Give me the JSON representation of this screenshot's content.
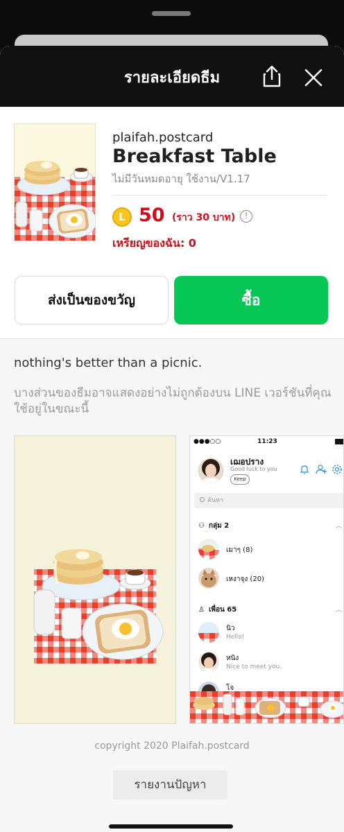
{
  "header": {
    "title": "รายละเอียดธีม"
  },
  "theme": {
    "author": "plaifah.postcard",
    "title": "Breakfast Table",
    "validity": "ไม่มีวันหมดอายุ ใช้งาน/V1.17",
    "coin_letter": "L",
    "price": "50",
    "price_approx": "(ราว  30 บาท)",
    "info_glyph": "!",
    "my_coins": "เหรียญของฉัน: 0"
  },
  "actions": {
    "gift_label": "ส่งเป็นของขวัญ",
    "buy_label": "ซื้อ"
  },
  "description": "nothing's better than a picnic.",
  "notice": "บางส่วนของธีมอาจแสดงอย่างไม่ถูกต้องบน LINE เวอร์ชันที่คุณใช้อยู่ในขณะนี้",
  "preview": {
    "status_dots": "●●●○○",
    "status_time": "11:23",
    "profile_name": "เฌอปราง",
    "profile_status": "Good luck to you",
    "keep_label": "Keep",
    "search_placeholder": "ค้นหา",
    "groups_header": "กลุ่ม 2",
    "groups": [
      {
        "name": "เมาๆ (8)"
      },
      {
        "name": "เหงาจุง (20)"
      }
    ],
    "friends_header": "เพื่อน 65",
    "friends": [
      {
        "name": "นิว",
        "message": "Hello!"
      },
      {
        "name": "หนิง",
        "message": "Nice to meet you."
      },
      {
        "name": "โจ",
        "message": ""
      }
    ]
  },
  "footer": {
    "copyright": "copyright 2020 Plaifah.postcard",
    "report_label": "รายงานปัญหา"
  },
  "colors": {
    "accent_green": "#06c755",
    "price_red": "#d40d1a",
    "header_bg": "#111111",
    "gingham_red": "#e8473c"
  }
}
